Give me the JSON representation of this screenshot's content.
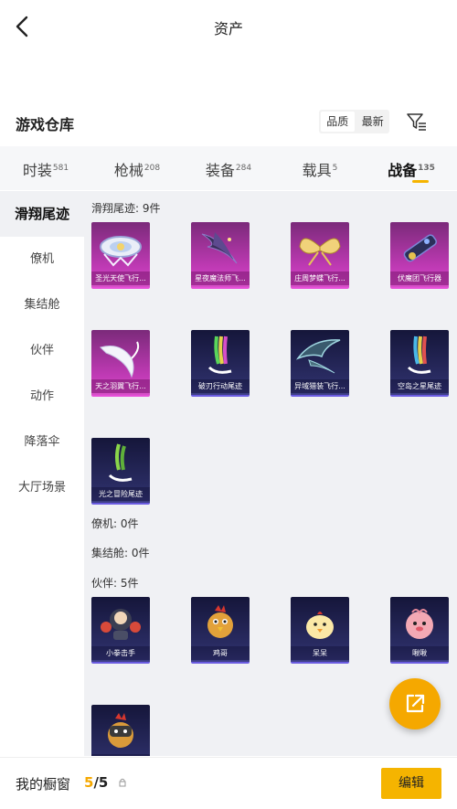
{
  "header": {
    "title": "资产"
  },
  "section": {
    "title": "游戏仓库"
  },
  "sort": {
    "options": [
      "品质",
      "最新"
    ],
    "active": 0
  },
  "tabs": [
    {
      "label": "时装",
      "count": "581"
    },
    {
      "label": "枪械",
      "count": "208"
    },
    {
      "label": "装备",
      "count": "284"
    },
    {
      "label": "载具",
      "count": "5"
    },
    {
      "label": "战备",
      "count": "135"
    }
  ],
  "sidebar": {
    "items": [
      {
        "label": "滑翔尾迹"
      },
      {
        "label": "僚机"
      },
      {
        "label": "集结舱"
      },
      {
        "label": "伙伴"
      },
      {
        "label": "动作"
      },
      {
        "label": "降落伞"
      },
      {
        "label": "大厅场景"
      }
    ]
  },
  "groups": {
    "trails": {
      "label": "滑翔尾迹: 9件",
      "items": [
        {
          "name": "圣光天使飞行...",
          "rarity": "pink",
          "icon": "halo-wing-icon"
        },
        {
          "name": "星夜魔法师飞...",
          "rarity": "pink",
          "icon": "night-mage-wing-icon"
        },
        {
          "name": "庄周梦蝶飞行...",
          "rarity": "pink",
          "icon": "butterfly-wing-icon"
        },
        {
          "name": "伏魔团飞行器",
          "rarity": "pink",
          "icon": "demon-craft-icon"
        },
        {
          "name": "天之羽翼飞行...",
          "rarity": "pink",
          "icon": "sky-feather-icon"
        },
        {
          "name": "破刃行动尾迹",
          "rarity": "purple",
          "icon": "rainbow-trail-icon"
        },
        {
          "name": "异域猎装飞行...",
          "rarity": "purple",
          "icon": "exotic-wing-icon"
        },
        {
          "name": "空岛之星尾迹",
          "rarity": "purple",
          "icon": "rainbow-trail-icon"
        },
        {
          "name": "光之冒险尾迹",
          "rarity": "purple",
          "icon": "green-trail-icon"
        }
      ]
    },
    "wingman": {
      "label": "僚机: 0件"
    },
    "pod": {
      "label": "集结舱: 0件"
    },
    "partner": {
      "label": "伙伴: 5件",
      "items": [
        {
          "name": "小拳击手",
          "rarity": "purple",
          "icon": "boxer-icon"
        },
        {
          "name": "鸡哥",
          "rarity": "purple",
          "icon": "chicken-icon"
        },
        {
          "name": "呆呆",
          "rarity": "purple",
          "icon": "chick-icon"
        },
        {
          "name": "啾啾",
          "rarity": "purple",
          "icon": "pink-bird-icon"
        },
        {
          "name": "",
          "rarity": "purple",
          "icon": "knight-chicken-icon"
        }
      ]
    }
  },
  "showcase": {
    "label": "我的橱窗",
    "current": "5",
    "sep": "/",
    "total": "5"
  },
  "edit": {
    "label": "编辑"
  },
  "colors": {
    "accent": "#f5b400",
    "pink": "#c03ab5",
    "purple": "#2a2c63"
  }
}
